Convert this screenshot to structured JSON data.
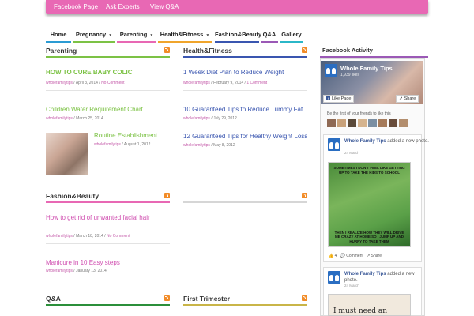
{
  "top_menu": {
    "items": [
      "Facebook Page",
      "Ask Experts",
      "View Q&A"
    ]
  },
  "nav": {
    "items": [
      {
        "label": "Home",
        "has_caret": false,
        "color": "#2b9bd3"
      },
      {
        "label": "Pregnancy",
        "has_caret": true,
        "color": "#7cc245"
      },
      {
        "label": "Parenting",
        "has_caret": true,
        "color": "#e868b4"
      },
      {
        "label": "Health&Fitness",
        "has_caret": true,
        "color": "#f0a52c"
      },
      {
        "label": "Fashion&Beauty",
        "has_caret": false,
        "color": "#3a56b0"
      },
      {
        "label": "Q&A",
        "has_caret": false,
        "color": "#9b59b6"
      },
      {
        "label": "Gallery",
        "has_caret": false,
        "color": "#2bb7c8"
      }
    ]
  },
  "parenting": {
    "title": "Parenting",
    "posts": [
      {
        "title": "HOW TO CURE BABY COLIC",
        "author": "wholefamilytips",
        "date": "April 3, 2014",
        "comments": "No Comment"
      },
      {
        "title": "Children Water Requirement Chart",
        "author": "wholefamilytips",
        "date": "March 25, 2014"
      },
      {
        "title": "Routine Establishment",
        "author": "wholefamilytips",
        "date": "August 1, 2012"
      }
    ]
  },
  "health": {
    "title": "Health&Fitness",
    "posts": [
      {
        "title": "1 Week Diet Plan to Reduce Weight",
        "author": "wholefamilytips",
        "date": "February 9, 2014",
        "comments": "1 Comment"
      },
      {
        "title": "10 Guaranteed Tips to Reduce Tummy Fat",
        "author": "wholefamilytips",
        "date": "July 29, 2012"
      },
      {
        "title": "12 Guaranteed Tips for Healthy Weight Loss",
        "author": "wholefamilytips",
        "date": "May 8, 2012"
      }
    ]
  },
  "fashion": {
    "title": "Fashion&Beauty",
    "posts": [
      {
        "title": "How to get rid of unwanted facial hair",
        "author": "wholefamilytips",
        "date": "March 18, 2014",
        "comments": "No Comment"
      },
      {
        "title": "Manicure in 10 Easy steps",
        "author": "wholefamilytips",
        "date": "January 13, 2014"
      }
    ]
  },
  "qa": {
    "title": "Q&A"
  },
  "first_trimester": {
    "title": "First Trimester"
  },
  "sidebar": {
    "title": "Facebook Activity",
    "page_name": "Whole Family Tips",
    "likes": "1,939 likes",
    "like_button": "Like Page",
    "share_button": "Share",
    "friends_text": "Be the first of your friends to like this",
    "post1": {
      "name": "Whole Family Tips",
      "action": "added a new photo.",
      "date": "24 March",
      "image_text_top": "SOMETIMES I DON'T FEEL LIKE GETTING UP TO TAKE THE KIDS TO SCHOOL",
      "image_text_bottom": "THEN I REALIZE HOW THEY WILL DRIVE ME CRAZY AT HOME SO I JUMP UP AND HURRY TO TAKE THEM",
      "likes": "4",
      "comment": "Comment",
      "share": "Share"
    },
    "post2": {
      "name": "Whole Family Tips",
      "action": "added a new photo.",
      "date": "24 March",
      "image_text": "I must need an"
    }
  }
}
